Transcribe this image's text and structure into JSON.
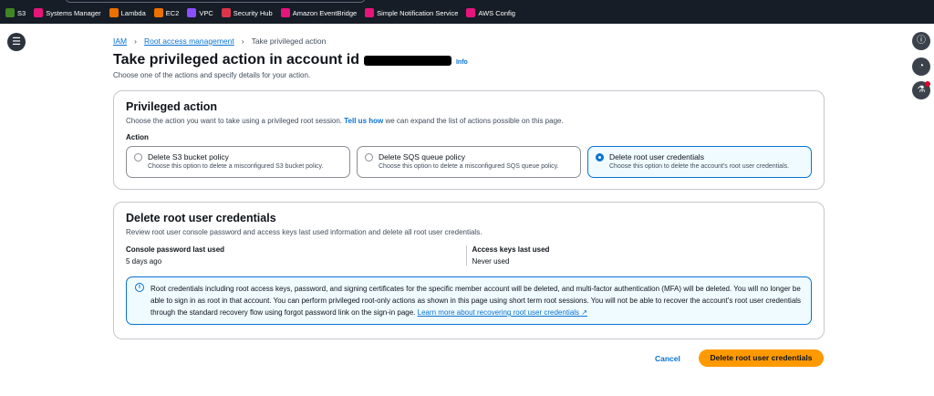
{
  "top_nav": {
    "services": [
      {
        "label": "S3",
        "color": "#3f8624"
      },
      {
        "label": "Systems Manager",
        "color": "#e7157b"
      },
      {
        "label": "Lambda",
        "color": "#ed7100"
      },
      {
        "label": "EC2",
        "color": "#ed7100"
      },
      {
        "label": "VPC",
        "color": "#8c4fff"
      },
      {
        "label": "Security Hub",
        "color": "#dd344c"
      },
      {
        "label": "Amazon EventBridge",
        "color": "#e7157b"
      },
      {
        "label": "Simple Notification Service",
        "color": "#e7157b"
      },
      {
        "label": "AWS Config",
        "color": "#e7157b"
      }
    ]
  },
  "breadcrumb": {
    "items": [
      "IAM",
      "Root access management"
    ],
    "current": "Take privileged action"
  },
  "page": {
    "title": "Take privileged action in account id",
    "info": "Info",
    "subtitle": "Choose one of the actions and specify details for your action."
  },
  "privileged": {
    "title": "Privileged action",
    "desc_pre": "Choose the action you want to take using a privileged root session. ",
    "desc_link": "Tell us how",
    "desc_post": " we can expand the list of actions possible on this page.",
    "action_label": "Action",
    "options": [
      {
        "title": "Delete S3 bucket policy",
        "desc": "Choose this option to delete a misconfigured S3 bucket policy."
      },
      {
        "title": "Delete SQS queue policy",
        "desc": "Choose this option to delete a misconfigured SQS queue policy."
      },
      {
        "title": "Delete root user credentials",
        "desc": "Choose this option to delete the account's root user credentials."
      }
    ]
  },
  "delete": {
    "title": "Delete root user credentials",
    "desc": "Review root user console password and access keys last used information and delete all root user credentials.",
    "console_label": "Console password last used",
    "console_value": "5 days ago",
    "keys_label": "Access keys last used",
    "keys_value": "Never used",
    "alert": "Root credentials including root access keys, password, and signing certificates for the specific member account will be deleted, and multi-factor authentication (MFA) will be deleted. You will no longer be able to sign in as root in that account. You can perform privileged root-only actions as shown in this page using short term root sessions. You will not be able to recover the account's root user credentials through the standard recovery flow using forgot password link on the sign-in page. ",
    "alert_link": "Learn more about recovering root user credentials"
  },
  "actions": {
    "cancel": "Cancel",
    "primary": "Delete root user credentials"
  }
}
